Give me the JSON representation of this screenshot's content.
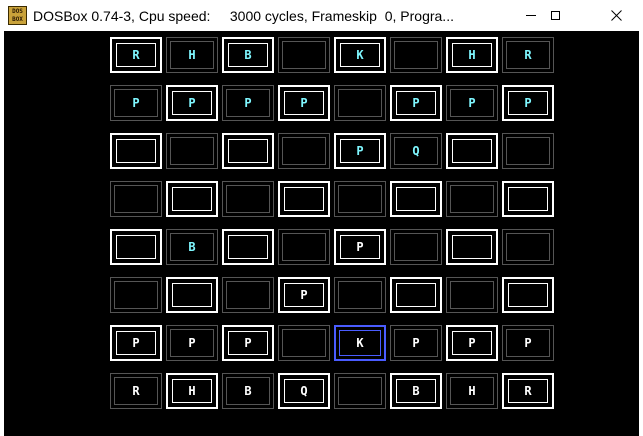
{
  "window": {
    "title": "DOSBox 0.74-3, Cpu speed:     3000 cycles, Frameskip  0, Progra...",
    "icon_lines": [
      "DOS",
      "BOX"
    ],
    "controls": [
      "minimize",
      "maximize",
      "close"
    ]
  },
  "colors": {
    "white_piece": "#ffffff",
    "black_piece": "#7ff7ff",
    "light_square_border": "#ffffff",
    "dark_square_border": "#555555",
    "selected_border": "#4a5cff",
    "background": "#000000"
  },
  "board": {
    "selected": [
      6,
      4
    ],
    "rows": [
      [
        {
          "piece": "R",
          "side": "black"
        },
        {
          "piece": "H",
          "side": "black"
        },
        {
          "piece": "B",
          "side": "black"
        },
        {
          "piece": "",
          "side": ""
        },
        {
          "piece": "K",
          "side": "black"
        },
        {
          "piece": "",
          "side": ""
        },
        {
          "piece": "H",
          "side": "black"
        },
        {
          "piece": "R",
          "side": "black"
        }
      ],
      [
        {
          "piece": "P",
          "side": "black"
        },
        {
          "piece": "P",
          "side": "black"
        },
        {
          "piece": "P",
          "side": "black"
        },
        {
          "piece": "P",
          "side": "black"
        },
        {
          "piece": "",
          "side": ""
        },
        {
          "piece": "P",
          "side": "black"
        },
        {
          "piece": "P",
          "side": "black"
        },
        {
          "piece": "P",
          "side": "black"
        }
      ],
      [
        {
          "piece": "",
          "side": ""
        },
        {
          "piece": "",
          "side": ""
        },
        {
          "piece": "",
          "side": ""
        },
        {
          "piece": "",
          "side": ""
        },
        {
          "piece": "P",
          "side": "black"
        },
        {
          "piece": "Q",
          "side": "black"
        },
        {
          "piece": "",
          "side": ""
        },
        {
          "piece": "",
          "side": ""
        }
      ],
      [
        {
          "piece": "",
          "side": ""
        },
        {
          "piece": "",
          "side": ""
        },
        {
          "piece": "",
          "side": ""
        },
        {
          "piece": "",
          "side": ""
        },
        {
          "piece": "",
          "side": ""
        },
        {
          "piece": "",
          "side": ""
        },
        {
          "piece": "",
          "side": ""
        },
        {
          "piece": "",
          "side": ""
        }
      ],
      [
        {
          "piece": "",
          "side": ""
        },
        {
          "piece": "B",
          "side": "black"
        },
        {
          "piece": "",
          "side": ""
        },
        {
          "piece": "",
          "side": ""
        },
        {
          "piece": "P",
          "side": "white"
        },
        {
          "piece": "",
          "side": ""
        },
        {
          "piece": "",
          "side": ""
        },
        {
          "piece": "",
          "side": ""
        }
      ],
      [
        {
          "piece": "",
          "side": ""
        },
        {
          "piece": "",
          "side": ""
        },
        {
          "piece": "",
          "side": ""
        },
        {
          "piece": "P",
          "side": "white"
        },
        {
          "piece": "",
          "side": ""
        },
        {
          "piece": "",
          "side": ""
        },
        {
          "piece": "",
          "side": ""
        },
        {
          "piece": "",
          "side": ""
        }
      ],
      [
        {
          "piece": "P",
          "side": "white"
        },
        {
          "piece": "P",
          "side": "white"
        },
        {
          "piece": "P",
          "side": "white"
        },
        {
          "piece": "",
          "side": ""
        },
        {
          "piece": "K",
          "side": "white"
        },
        {
          "piece": "P",
          "side": "white"
        },
        {
          "piece": "P",
          "side": "white"
        },
        {
          "piece": "P",
          "side": "white"
        }
      ],
      [
        {
          "piece": "R",
          "side": "white"
        },
        {
          "piece": "H",
          "side": "white"
        },
        {
          "piece": "B",
          "side": "white"
        },
        {
          "piece": "Q",
          "side": "white"
        },
        {
          "piece": "",
          "side": ""
        },
        {
          "piece": "B",
          "side": "white"
        },
        {
          "piece": "H",
          "side": "white"
        },
        {
          "piece": "R",
          "side": "white"
        }
      ]
    ]
  }
}
